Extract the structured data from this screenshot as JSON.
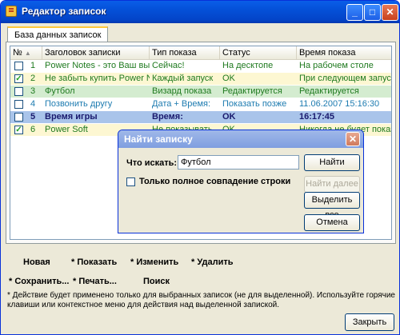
{
  "window": {
    "title": "Редактор записок",
    "min_label": "_",
    "max_label": "□",
    "close_label": "✕"
  },
  "tab": {
    "label": "База данных записок"
  },
  "table": {
    "headers": [
      "№",
      "Заголовок записки",
      "Тип показа",
      "Статус",
      "Время показа"
    ],
    "rows": [
      {
        "checked": false,
        "num": "1",
        "title": "Power Notes - это Ваш выбор!",
        "type": "Сейчас!",
        "status": "На десктопе",
        "time": "На рабочем столе",
        "text_color": "#1f7a1f",
        "bg": "#ffffff",
        "bold": false
      },
      {
        "checked": true,
        "num": "2",
        "title": "Не забыть купить Power Notes",
        "type": "Каждый запуск",
        "status": "OK",
        "time": "При следующем запуске",
        "text_color": "#1f7a1f",
        "bg": "#fdf7d2",
        "bold": false
      },
      {
        "checked": false,
        "num": "3",
        "title": "Футбол",
        "type": "Визард показа",
        "status": "Редактируется",
        "time": "Редактируется",
        "text_color": "#1f7a1f",
        "bg": "#d4ecd0",
        "bold": false
      },
      {
        "checked": false,
        "num": "4",
        "title": "Позвонить другу",
        "type": "Дата + Время:",
        "status": "Показать позже",
        "time": "11.06.2007 15:16:30",
        "text_color": "#1d7bb0",
        "bg": "#ffffff",
        "bold": false
      },
      {
        "checked": false,
        "num": "5",
        "title": "Время игры",
        "type": "Время:",
        "status": "OK",
        "time": "16:17:45",
        "text_color": "#1a1a6e",
        "bg": "#a9c4ea",
        "bold": true
      },
      {
        "checked": true,
        "num": "6",
        "title": "Power Soft",
        "type": "Не показывать",
        "status": "OK",
        "time": "Никогда не будет показана",
        "text_color": "#1f7a1f",
        "bg": "#fdf7d2",
        "bold": false
      }
    ]
  },
  "toolbar": {
    "new": "Новая",
    "show": "* Показать",
    "edit": "* Изменить",
    "delete": "* Удалить",
    "save": "* Сохранить...",
    "print": "* Печать...",
    "search": "Поиск"
  },
  "note": "* Действие будет применено только для выбранных записок (не для выделенной). Используйте горячие клавиши или контекстное меню для действия над выделенной запиской.",
  "close_button": "Закрыть",
  "dialog": {
    "title": "Найти записку",
    "close_label": "✕",
    "search_label": "Что искать:",
    "search_value": "Футбол",
    "exact_match_label": "Только полное совпадение строки",
    "exact_match_checked": false,
    "find_button": "Найти",
    "find_next_button": "Найти далее",
    "select_all_button": "Выделить все",
    "cancel_button": "Отмена"
  }
}
